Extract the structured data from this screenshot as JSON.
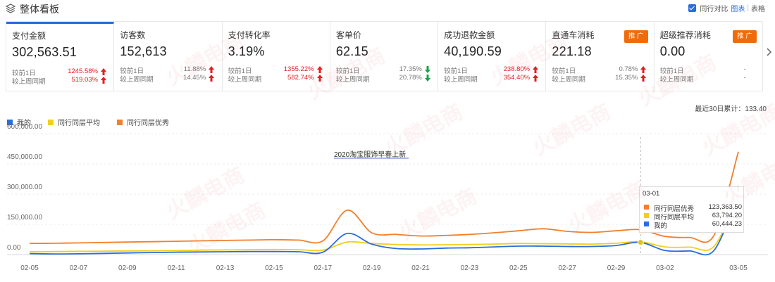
{
  "header": {
    "title": "整体看板",
    "peer_compare_label": "同行对比",
    "view_chart_label": "图表",
    "separator": "|",
    "view_table_label": "表格"
  },
  "kpis": [
    {
      "name": "支付金额",
      "value": "302,563.51",
      "day_label": "较前1日",
      "day_pct": "1245.58%",
      "week_label": "较上周同期",
      "week_pct": "519.03%",
      "active": true
    },
    {
      "name": "访客数",
      "value": "152,613",
      "day_label": "较前1日",
      "day_pct": "11.88%",
      "week_label": "较上周同期",
      "week_pct": "14.45%"
    },
    {
      "name": "支付转化率",
      "value": "3.19%",
      "day_label": "较前1日",
      "day_pct": "1355.22%",
      "week_label": "较上周同期",
      "week_pct": "582.74%"
    },
    {
      "name": "客单价",
      "value": "62.15",
      "day_label": "较前1日",
      "day_pct": "17.35%",
      "week_label": "较上周同期",
      "week_pct": "20.78%"
    },
    {
      "name": "成功退款金额",
      "value": "40,190.59",
      "day_label": "较前1日",
      "day_pct": "238.80%",
      "week_label": "较上周同期",
      "week_pct": "354.40%"
    },
    {
      "name": "直通车消耗",
      "value": "221.18",
      "day_label": "较前1日",
      "day_pct": "0.78%",
      "week_label": "较上周同期",
      "week_pct": "15.35%",
      "promo": "推 广"
    },
    {
      "name": "超级推荐消耗",
      "value": "0.00",
      "day_label": "较前1日",
      "day_pct": "-",
      "week_label": "较上周同期",
      "week_pct": "-",
      "promo": "推 广"
    }
  ],
  "summary": "最近30日累计：133.40",
  "annotation": "2020淘宝服饰早春上新",
  "tooltip": {
    "date": "03-01",
    "rows": [
      {
        "name": "同行同层优秀",
        "value": "123,363.50",
        "color": "#f0812c"
      },
      {
        "name": "同行同层平均",
        "value": "63,794.20",
        "color": "#f2cf1a"
      },
      {
        "name": "我的",
        "value": "60,444.23",
        "color": "#2a6dde"
      }
    ]
  },
  "watermark": "火麟电商",
  "colors": {
    "accent": "#2a6dde",
    "up": "#e02020",
    "down": "#17a34a",
    "promo": "#f06c0a"
  },
  "chart_data": {
    "type": "line",
    "x": [
      "02-05",
      "02-06",
      "02-07",
      "02-08",
      "02-09",
      "02-10",
      "02-11",
      "02-12",
      "02-13",
      "02-14",
      "02-15",
      "02-16",
      "02-17",
      "02-18",
      "02-19",
      "02-20",
      "02-21",
      "02-22",
      "02-23",
      "02-24",
      "02-25",
      "02-26",
      "02-27",
      "02-28",
      "02-29",
      "03-01",
      "03-02",
      "03-03",
      "03-04",
      "03-05"
    ],
    "x_ticks": [
      "02-05",
      "02-07",
      "02-09",
      "02-11",
      "02-13",
      "02-15",
      "02-17",
      "02-19",
      "02-21",
      "02-23",
      "02-25",
      "02-27",
      "02-29",
      "03-02",
      "03-05"
    ],
    "y_ticks": [
      "0.00",
      "150,000.00",
      "300,000.00",
      "450,000.00",
      "600,000.00"
    ],
    "ylim": [
      0,
      600000
    ],
    "series": [
      {
        "name": "我的",
        "color": "#2a6dde",
        "values": [
          5000,
          3000,
          4000,
          6000,
          8000,
          10000,
          12000,
          13000,
          14000,
          15000,
          15000,
          14000,
          12000,
          105000,
          52000,
          30000,
          28000,
          32000,
          34000,
          38000,
          42000,
          42000,
          40000,
          40000,
          45000,
          60444,
          20000,
          18000,
          20000,
          300000
        ]
      },
      {
        "name": "同行同层平均",
        "color": "#f2cf1a",
        "values": [
          14000,
          15000,
          16000,
          17000,
          18000,
          19000,
          20000,
          22000,
          23000,
          24000,
          25000,
          24000,
          22000,
          62000,
          55000,
          50000,
          48000,
          49000,
          50000,
          52000,
          55000,
          54000,
          53000,
          52000,
          56000,
          63794,
          38000,
          37000,
          40000,
          290000
        ]
      },
      {
        "name": "同行同层优秀",
        "color": "#f0812c",
        "values": [
          55000,
          56000,
          58000,
          60000,
          62000,
          64000,
          66000,
          68000,
          70000,
          72000,
          74000,
          72000,
          68000,
          220000,
          108000,
          100000,
          92000,
          95000,
          100000,
          108000,
          118000,
          128000,
          115000,
          110000,
          118000,
          123363,
          90000,
          85000,
          95000,
          510000
        ]
      }
    ]
  }
}
